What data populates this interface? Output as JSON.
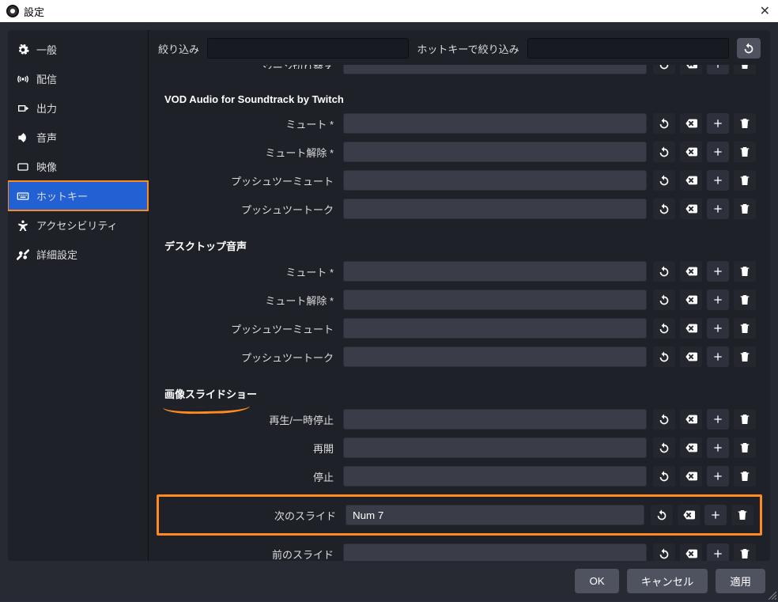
{
  "window": {
    "title": "設定"
  },
  "sidebar": {
    "items": [
      {
        "icon": "gear",
        "label": "一般"
      },
      {
        "icon": "broadcast",
        "label": "配信"
      },
      {
        "icon": "output",
        "label": "出力"
      },
      {
        "icon": "audio",
        "label": "音声"
      },
      {
        "icon": "video",
        "label": "映像"
      },
      {
        "icon": "keyboard",
        "label": "ホットキー",
        "selected": true
      },
      {
        "icon": "accessibility",
        "label": "アクセシビリティ"
      },
      {
        "icon": "advanced",
        "label": "詳細設定"
      }
    ]
  },
  "filterbar": {
    "filter_label": "絞り込み",
    "filter_value": "",
    "hotkey_filter_label": "ホットキーで絞り込み",
    "hotkey_filter_value": ""
  },
  "groups": [
    {
      "title": "",
      "rows": [
        {
          "label": "シーン切り替え",
          "value": "",
          "partial_top": true
        }
      ]
    },
    {
      "title": "VOD Audio for Soundtrack by Twitch",
      "rows": [
        {
          "label": "ミュート *",
          "value": ""
        },
        {
          "label": "ミュート解除 *",
          "value": ""
        },
        {
          "label": "プッシュツーミュート",
          "value": ""
        },
        {
          "label": "プッシュツートーク",
          "value": ""
        }
      ]
    },
    {
      "title": "デスクトップ音声",
      "rows": [
        {
          "label": "ミュート *",
          "value": ""
        },
        {
          "label": "ミュート解除 *",
          "value": ""
        },
        {
          "label": "プッシュツーミュート",
          "value": ""
        },
        {
          "label": "プッシュツートーク",
          "value": ""
        }
      ]
    },
    {
      "title": "画像スライドショー",
      "annotated": true,
      "rows": [
        {
          "label": "再生/一時停止",
          "value": ""
        },
        {
          "label": "再開",
          "value": ""
        },
        {
          "label": "停止",
          "value": ""
        },
        {
          "label": "次のスライド",
          "value": "Num 7",
          "highlight": true
        },
        {
          "label": "前のスライド",
          "value": ""
        }
      ]
    }
  ],
  "footer": {
    "ok": "OK",
    "cancel": "キャンセル",
    "apply": "適用"
  },
  "icons": {
    "revert": "revert-icon",
    "clear": "clear-icon",
    "add": "add-icon",
    "delete": "delete-icon"
  }
}
